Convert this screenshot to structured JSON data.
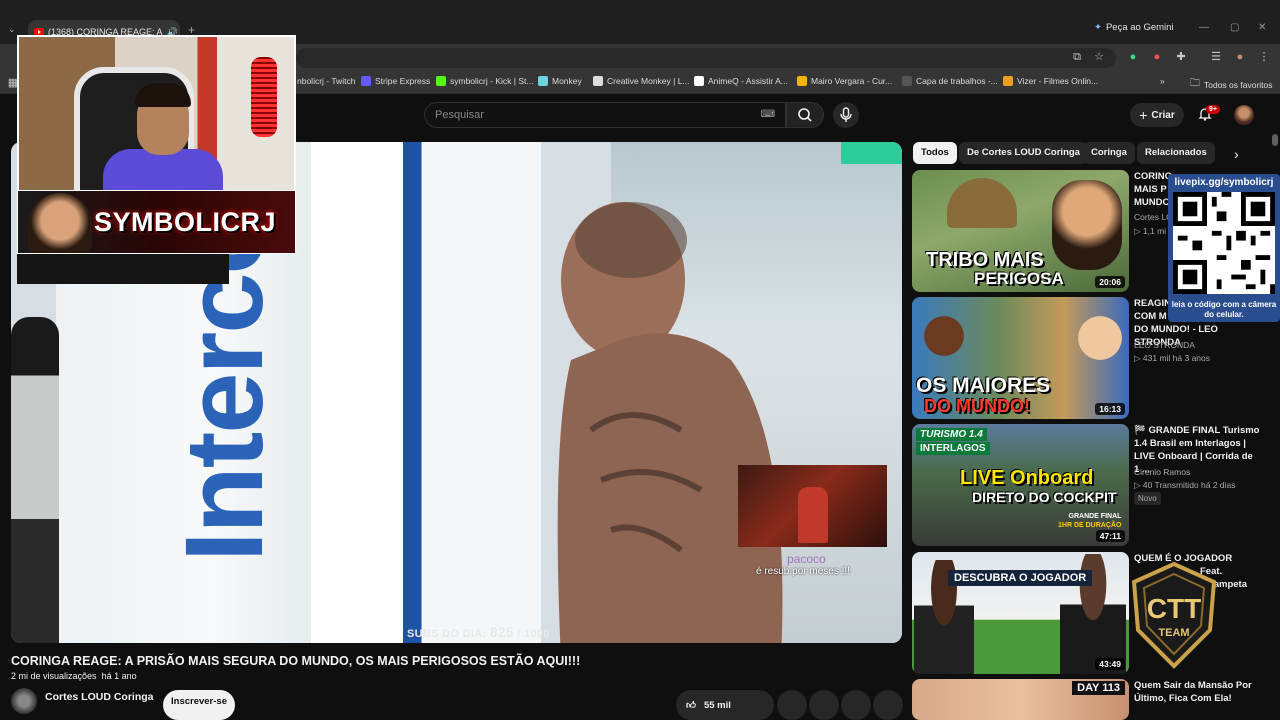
{
  "browser": {
    "tab_title": "(1368) CORINGA REAGE: A",
    "gemini_label": "Peça ao Gemini",
    "bookmarks": [
      {
        "label": "nbolicrj - Twitch",
        "color": "#9146ff"
      },
      {
        "label": "Stripe Express",
        "color": "#635bff"
      },
      {
        "label": "symbolicrj - Kick | St...",
        "color": "#53fc18"
      },
      {
        "label": "Monkey",
        "color": "#6ad5e0"
      },
      {
        "label": "Creative Monkey | L...",
        "color": "#dddddd"
      },
      {
        "label": "AnimeQ - Assistir A...",
        "color": "#ffffff"
      },
      {
        "label": "Mairo Vergara - Cur...",
        "color": "#f5b400"
      },
      {
        "label": "Capa de trabalhos -...",
        "color": "#555555"
      },
      {
        "label": "Vizer - Filmes Onlin...",
        "color": "#f0a020"
      }
    ],
    "bookmarks_overflow": "»",
    "all_bookmarks": "Todos os favoritos"
  },
  "youtube": {
    "search_placeholder": "Pesquisar",
    "create_label": "Criar",
    "notif_badge": "9+"
  },
  "overlay": {
    "streamer_name": "SYMBOLICRJ",
    "subs_label": "SUBS DO DIA:",
    "subs_count": "825",
    "subs_goal": "/ 1000",
    "resub_name": "pacoco",
    "resub_text": "é resub por  meses !!!",
    "qr_url": "livepix.gg/symbolicrj",
    "qr_caption": "leia o código com a câmera do celular.",
    "team_logo": "CTT TEAM"
  },
  "player": {
    "wall_brand": "Interco"
  },
  "video": {
    "title": "CORINGA REAGE: A PRISÃO MAIS SEGURA DO MUNDO, OS MAIS PERIGOSOS ESTÃO AQUI!!!",
    "views": "2 mi de visualizações",
    "age": "há 1 ano",
    "channel": "Cortes LOUD Coringa",
    "subscribe_label": "Inscrever-se",
    "likes": "55 mil"
  },
  "chips": [
    "Todos",
    "De Cortes LOUD Coringa",
    "Coringa",
    "Relacionados"
  ],
  "related": [
    {
      "title_lines": [
        "CORING",
        "MAIS P",
        "MUNDO"
      ],
      "channel": "Cortes LO",
      "stats": "▷ 1,1 mi",
      "duration": "20:06",
      "thumb_text": [
        "TRIBO MAIS",
        "PERIGOSA"
      ]
    },
    {
      "title_lines": [
        "REAGIN",
        "COM M",
        "DO MUNDO! - LEO STRONDA"
      ],
      "channel": "LEO STRONDA",
      "stats": "▷ 431 mil   há 3 anos",
      "duration": "16:13",
      "thumb_text": [
        "OS MAIORES",
        "DO MUNDO!"
      ]
    },
    {
      "title_lines": [
        "🏁 GRANDE FINAL Turismo",
        "1.4 Brasil em Interlagos |",
        "LIVE Onboard | Corrida de 1 ..."
      ],
      "channel": "Cirenio Ramos",
      "stats": "▷ 40   Transmitido há 2 dias",
      "badge": "Novo",
      "duration": "47:11",
      "thumb_text": [
        "LIVE Onboard",
        "DIRETO DO COCKPIT",
        "TURISMO 1.4",
        "INTERLAGOS",
        "GRANDE FINAL",
        "1HR DE DURAÇÃO"
      ]
    },
    {
      "title_lines": [
        "QUEM É O JOGADOR",
        "Feat.",
        "e Vampeta"
      ],
      "duration": "43:49",
      "thumb_text": [
        "DESCUBRA O JOGADOR"
      ]
    },
    {
      "title_lines": [
        "Quem Sair da Mansão Por",
        "Último, Fica Com Ela!"
      ],
      "thumb_text": [
        "DAY 113"
      ]
    }
  ]
}
